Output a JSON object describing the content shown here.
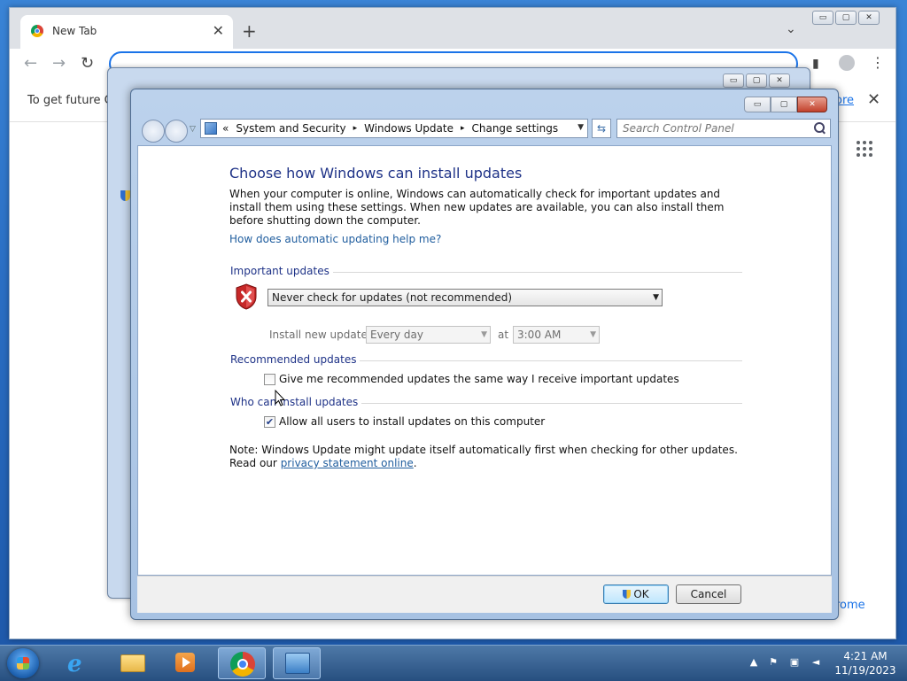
{
  "chrome": {
    "tab_title": "New Tab",
    "tab_close": "✕",
    "new_tab": "+",
    "info_text": "To get future Go",
    "info_more": "ore",
    "info_close": "✕",
    "promo_text": "rome"
  },
  "window": {
    "minimize": "▭",
    "maximize": "▢",
    "close": "✕"
  },
  "address_bar": {
    "crumbs": [
      "«",
      "System and Security",
      "▸",
      "Windows Update",
      "▸",
      "Change settings"
    ],
    "search_placeholder": "Search Control Panel"
  },
  "page": {
    "title": "Choose how Windows can install updates",
    "intro": "When your computer is online, Windows can automatically check for important updates and install them using these settings. When new updates are available, you can also install them before shutting down the computer.",
    "help_link": "How does automatic updating help me?",
    "important_updates": {
      "heading": "Important updates",
      "selected_option": "Never check for updates (not recommended)",
      "install_label": "Install new updates:",
      "frequency": "Every day",
      "at_label": "at",
      "time": "3:00 AM"
    },
    "recommended_updates": {
      "heading": "Recommended updates",
      "checkbox_label": "Give me recommended updates the same way I receive important updates",
      "checked": false
    },
    "who_can_install": {
      "heading": "Who can install updates",
      "checkbox_label": "Allow all users to install updates on this computer",
      "checked": true
    },
    "note": "Note: Windows Update might update itself automatically first when checking for other updates.  Read our",
    "privacy_link": "privacy statement online",
    "note_end": "."
  },
  "buttons": {
    "ok": "OK",
    "cancel": "Cancel"
  },
  "taskbar": {
    "time": "4:21 AM",
    "date": "11/19/2023"
  },
  "colors": {
    "heading_blue": "#1e3287",
    "link_blue": "#1f5d9e",
    "chrome_accent": "#1a73e8"
  }
}
